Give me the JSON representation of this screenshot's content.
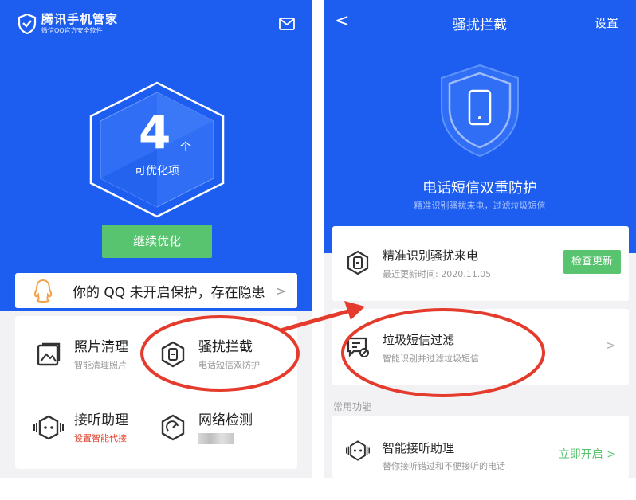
{
  "left": {
    "app_title": "腾讯手机管家",
    "app_subtitle": "微信QQ官方安全软件",
    "optimize_count": "4",
    "optimize_unit": "个",
    "optimize_label": "可优化项",
    "continue_button": "继续优化",
    "warning_text": "你的 QQ 未开启保护，存在隐患",
    "features": [
      {
        "title": "照片清理",
        "subtitle": "智能清理照片",
        "icon": "photo-icon"
      },
      {
        "title": "骚扰拦截",
        "subtitle": "电话短信双防护",
        "icon": "block-icon"
      },
      {
        "title": "接听助理",
        "subtitle": "设置智能代接",
        "icon": "robot-icon"
      },
      {
        "title": "网络检测",
        "subtitle": "",
        "icon": "network-icon"
      }
    ]
  },
  "right": {
    "back": "<",
    "page_title": "骚扰拦截",
    "settings": "设置",
    "hero_title": "电话短信双重防护",
    "hero_subtitle": "精准识别骚扰来电，过滤垃圾短信",
    "card_call": {
      "title": "精准识别骚扰来电",
      "subtitle": "最近更新时间: 2020.11.05",
      "button": "检查更新"
    },
    "card_sms": {
      "title": "垃圾短信过滤",
      "subtitle": "智能识别并过滤垃圾短信"
    },
    "section_label": "常用功能",
    "card_assistant": {
      "title": "智能接听助理",
      "subtitle": "替你接听错过和不便接听的电话",
      "link": "立即开启 >"
    }
  },
  "colors": {
    "primary_blue": "#1d5ef0",
    "green": "#59c46f",
    "red_annotation": "#e53b2c",
    "warning_orange": "#f2a24a"
  }
}
